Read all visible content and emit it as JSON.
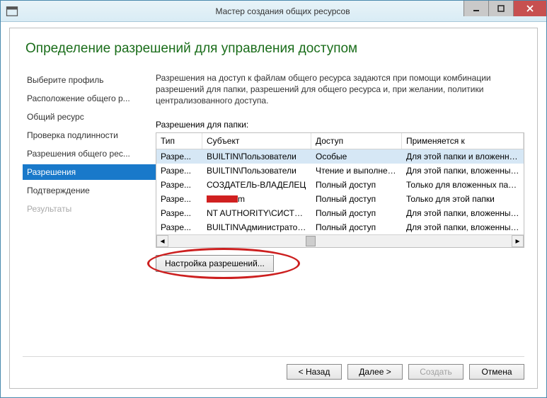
{
  "window": {
    "title": "Мастер создания общих ресурсов"
  },
  "heading": "Определение разрешений для управления доступом",
  "nav": {
    "items": [
      {
        "label": "Выберите профиль"
      },
      {
        "label": "Расположение общего р..."
      },
      {
        "label": "Общий ресурс"
      },
      {
        "label": "Проверка подлинности"
      },
      {
        "label": "Разрешения общего рес..."
      },
      {
        "label": "Разрешения"
      },
      {
        "label": "Подтверждение"
      },
      {
        "label": "Результаты"
      }
    ]
  },
  "content": {
    "description": "Разрешения на доступ к файлам общего ресурса задаются при помощи комбинации разрешений для папки, разрешений для общего ресурса и, при желании, политики централизованного доступа.",
    "folder_label": "Разрешения для папки:",
    "columns": {
      "type": "Тип",
      "subject": "Субъект",
      "access": "Доступ",
      "applies": "Применяется к"
    },
    "rows": [
      {
        "type": "Разре...",
        "subject": "BUILTIN\\Пользователи",
        "access": "Особые",
        "applies": "Для этой папки и вложенных "
      },
      {
        "type": "Разре...",
        "subject": "BUILTIN\\Пользователи",
        "access": "Чтение и выполнени...",
        "applies": "Для этой папки, вложенных па"
      },
      {
        "type": "Разре...",
        "subject": "СОЗДАТЕЛЬ-ВЛАДЕЛЕЦ",
        "access": "Полный доступ",
        "applies": "Только для вложенных папок "
      },
      {
        "type": "Разре...",
        "subject": "",
        "access": "Полный доступ",
        "applies": "Только для этой папки"
      },
      {
        "type": "Разре...",
        "subject": "NT AUTHORITY\\СИСТЕМА",
        "access": "Полный доступ",
        "applies": "Для этой папки, вложенных па"
      },
      {
        "type": "Разре...",
        "subject": "BUILTIN\\Администраторы",
        "access": "Полный доступ",
        "applies": "Для этой папки, вложенных па"
      }
    ],
    "redacted_suffix": "m",
    "configure_btn": "Настройка разрешений..."
  },
  "footer": {
    "back": "< Назад",
    "next": "Далее >",
    "create": "Создать",
    "cancel": "Отмена"
  }
}
